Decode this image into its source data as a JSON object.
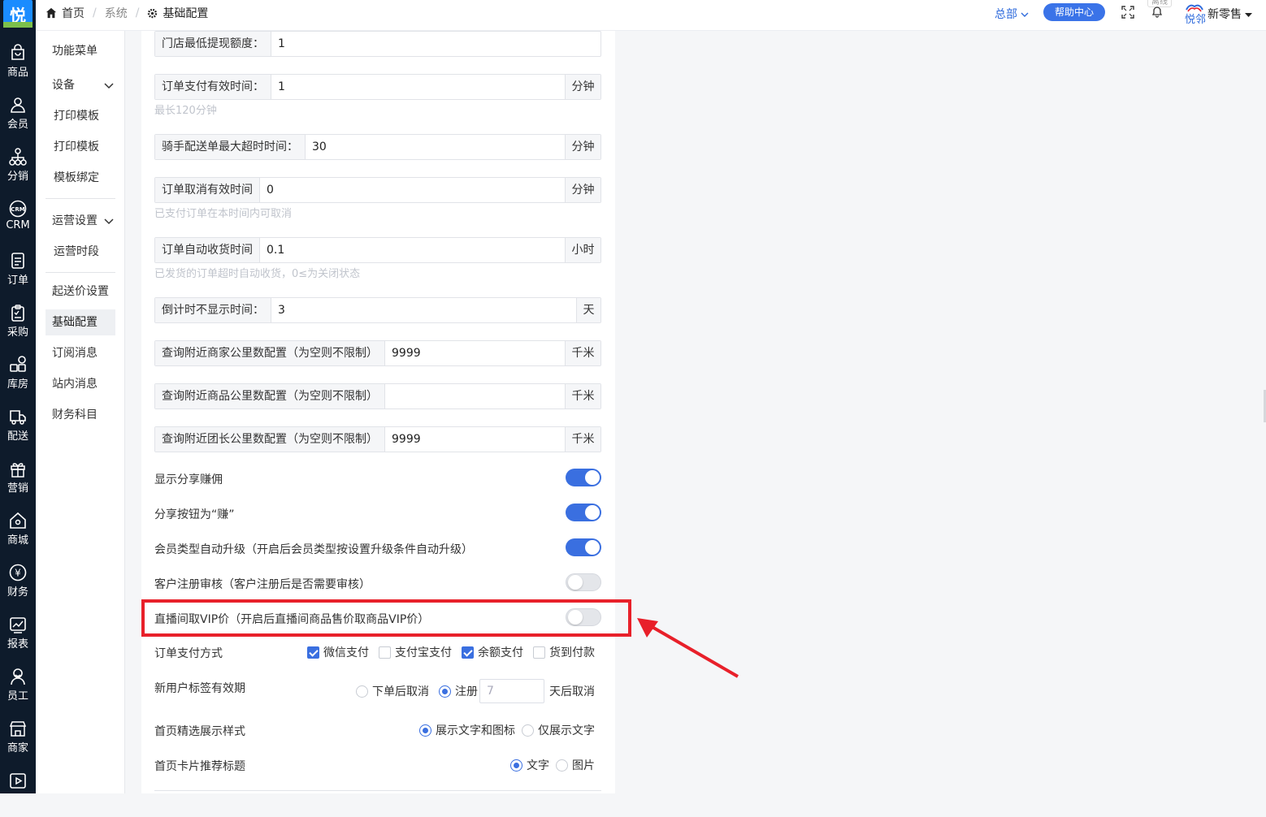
{
  "rail": {
    "logo": "悦",
    "items": [
      {
        "name": "rail-goods",
        "icon": "shopping-bag-icon",
        "label": "商品"
      },
      {
        "name": "rail-member",
        "icon": "user-icon",
        "label": "会员"
      },
      {
        "name": "rail-distribution",
        "icon": "org-tree-icon",
        "label": "分销"
      },
      {
        "name": "rail-crm",
        "icon": "crm-icon",
        "label": "CRM"
      },
      {
        "name": "rail-order",
        "icon": "document-icon",
        "label": "订单"
      },
      {
        "name": "rail-purchase",
        "icon": "clipboard-icon",
        "label": "采购"
      },
      {
        "name": "rail-warehouse",
        "icon": "grid-icon",
        "label": "库房"
      },
      {
        "name": "rail-delivery",
        "icon": "truck-icon",
        "label": "配送"
      },
      {
        "name": "rail-marketing",
        "icon": "gift-icon",
        "label": "营销"
      },
      {
        "name": "rail-mall",
        "icon": "home-icon",
        "label": "商城"
      },
      {
        "name": "rail-finance",
        "icon": "yen-icon",
        "label": "财务"
      },
      {
        "name": "rail-report",
        "icon": "chart-icon",
        "label": "报表"
      },
      {
        "name": "rail-staff",
        "icon": "staff-icon",
        "label": "员工"
      },
      {
        "name": "rail-merchant",
        "icon": "store-icon",
        "label": "商家"
      },
      {
        "name": "rail-video",
        "icon": "play-icon",
        "label": ""
      }
    ]
  },
  "header": {
    "crumb_home": "首页",
    "crumb_sep": "/",
    "crumb_system": "系统",
    "crumb_current": "基础配置",
    "branch": "总部",
    "help": "帮助中心",
    "status_tip": "离线",
    "brand_text": "悦邻",
    "user": "新零售"
  },
  "subnav": {
    "func_menu": "功能菜单",
    "device": "设备",
    "print_template_1": "打印模板",
    "print_template_2": "打印模板",
    "template_bind": "模板绑定",
    "ops_settings": "运营设置",
    "ops_period": "运营时段",
    "min_delivery": "起送价设置",
    "basic_config": "基础配置",
    "subscribe_msg": "订阅消息",
    "site_msg": "站内消息",
    "finance_subject": "财务科目"
  },
  "form": {
    "min_withdraw": {
      "label": "门店最低提现额度：",
      "value": "1"
    },
    "pay_valid": {
      "label": "订单支付有效时间：",
      "value": "1",
      "unit": "分钟",
      "hint": "最长120分钟"
    },
    "rider_timeout": {
      "label": "骑手配送单最大超时时间：",
      "value": "30",
      "unit": "分钟"
    },
    "cancel_valid": {
      "label": "订单取消有效时间",
      "value": "0",
      "unit": "分钟",
      "hint": "已支付订单在本时间内可取消"
    },
    "auto_receive": {
      "label": "订单自动收货时间",
      "value": "0.1",
      "unit": "小时",
      "hint": "已发货的订单超时自动收货，0≤为关闭状态"
    },
    "countdown_hide": {
      "label": "倒计时不显示时间：",
      "value": "3",
      "unit": "天"
    },
    "nearby_merchant": {
      "label": "查询附近商家公里数配置（为空则不限制）",
      "value": "9999",
      "unit": "千米"
    },
    "nearby_goods": {
      "label": "查询附近商品公里数配置（为空则不限制）",
      "value": "",
      "unit": "千米"
    },
    "nearby_leader": {
      "label": "查询附近团长公里数配置（为空则不限制）",
      "value": "9999",
      "unit": "千米"
    },
    "show_share_commission": {
      "label": "显示分享赚佣",
      "on": true
    },
    "share_btn_earn": {
      "label": "分享按钮为“赚”",
      "on": true
    },
    "member_auto_upgrade": {
      "label": "会员类型自动升级（开启后会员类型按设置升级条件自动升级）",
      "on": true
    },
    "customer_review": {
      "label": "客户注册审核（客户注册后是否需要审核）",
      "on": false
    },
    "live_vip_price": {
      "label": "直播间取VIP价（开启后直播间商品售价取商品VIP价）",
      "on": false
    },
    "pay_methods": {
      "label": "订单支付方式",
      "options": [
        {
          "label": "微信支付",
          "checked": true
        },
        {
          "label": "支付宝支付",
          "checked": false
        },
        {
          "label": "余额支付",
          "checked": true
        },
        {
          "label": "货到付款",
          "checked": false
        }
      ]
    },
    "new_user_tag": {
      "label": "新用户标签有效期",
      "opt_order_cancel": "下单后取消",
      "opt_register": "注册",
      "days_placeholder": "7",
      "suffix": "天后取消",
      "selected": "注册"
    },
    "home_featured_style": {
      "label": "首页精选展示样式",
      "opt_text_icon": "展示文字和图标",
      "opt_text_only": "仅展示文字",
      "selected": "展示文字和图标"
    },
    "home_card_title": {
      "label": "首页卡片推荐标题",
      "opt_text": "文字",
      "opt_image": "图片",
      "selected": "文字"
    }
  },
  "colors": {
    "rail_bg": "#0e1b2b",
    "accent": "#3a6fe0",
    "highlight": "#e8202a"
  }
}
